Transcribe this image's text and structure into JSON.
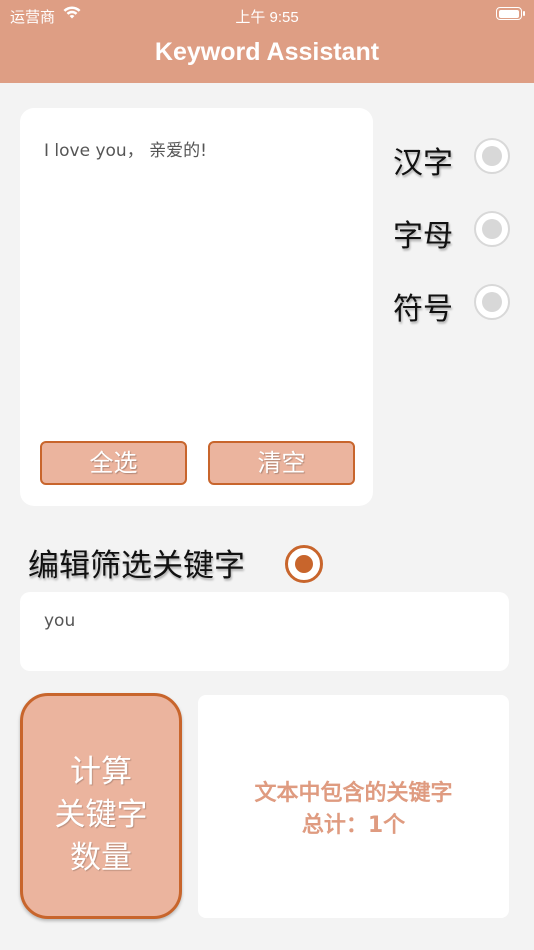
{
  "status_bar": {
    "carrier": "运营商",
    "time": "上午 9:55",
    "battery_level": 0.95
  },
  "nav": {
    "title": "Keyword Assistant"
  },
  "input": {
    "text": "I love you， 亲爱的!"
  },
  "buttons": {
    "select_all": "全选",
    "clear": "清空"
  },
  "options": [
    {
      "label": "汉字",
      "selected": false
    },
    {
      "label": "字母",
      "selected": false
    },
    {
      "label": "符号",
      "selected": false
    }
  ],
  "keyword": {
    "title": "编辑筛选关键字",
    "selected": true,
    "value": "you"
  },
  "calc_button": {
    "lines": [
      "计算",
      "关键字",
      "数量"
    ]
  },
  "result": {
    "lines": [
      "文本中包含的关键字",
      "总计：1个"
    ]
  },
  "colors": {
    "accent": "#de9e84",
    "button_fill": "#ebb49e",
    "button_border": "#c8652c",
    "result_text": "#df9b80"
  }
}
